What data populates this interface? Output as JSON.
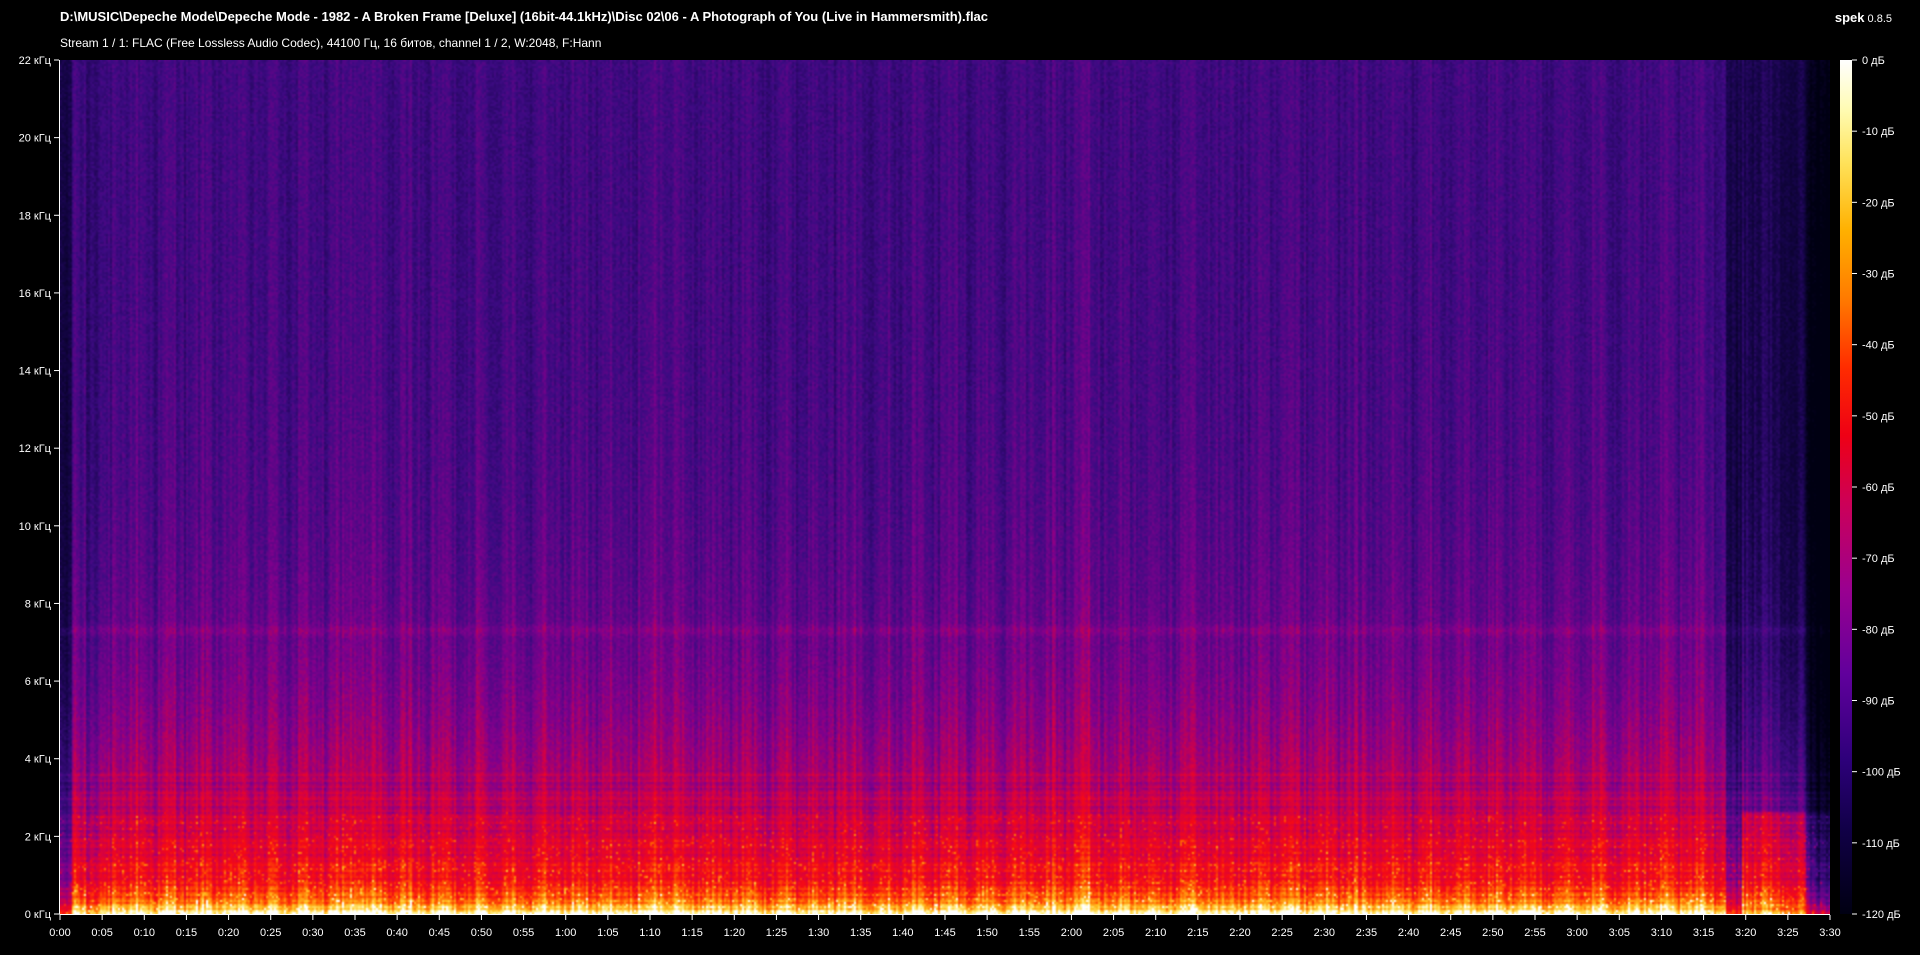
{
  "header": {
    "file_path": "D:\\MUSIC\\Depeche Mode\\Depeche Mode - 1982 - A Broken Frame [Deluxe] (16bit-44.1kHz)\\Disc 02\\06 - A Photograph of You (Live in Hammersmith).flac",
    "stream_info": "Stream 1 / 1: FLAC (Free Lossless Audio Codec), 44100 Гц, 16 битов, channel 1 / 2, W:2048, F:Hann",
    "app_name": "spek",
    "app_version": "0.8.5"
  },
  "chart_data": {
    "type": "heatmap",
    "x_ticks": [
      "0:00",
      "0:05",
      "0:10",
      "0:15",
      "0:20",
      "0:25",
      "0:30",
      "0:35",
      "0:40",
      "0:45",
      "0:50",
      "0:55",
      "1:00",
      "1:05",
      "1:10",
      "1:15",
      "1:20",
      "1:25",
      "1:30",
      "1:35",
      "1:40",
      "1:45",
      "1:50",
      "1:55",
      "2:00",
      "2:05",
      "2:10",
      "2:15",
      "2:20",
      "2:25",
      "2:30",
      "2:35",
      "2:40",
      "2:45",
      "2:50",
      "2:55",
      "3:00",
      "3:05",
      "3:10",
      "3:15",
      "3:20",
      "3:25",
      "3:30"
    ],
    "x_range_seconds": [
      0,
      210
    ],
    "y_ticks": [
      "0 кГц",
      "2 кГц",
      "4 кГц",
      "6 кГц",
      "8 кГц",
      "10 кГц",
      "12 кГц",
      "14 кГц",
      "16 кГц",
      "18 кГц",
      "20 кГц",
      "22 кГц"
    ],
    "y_range_khz": [
      0,
      22
    ],
    "colorbar_ticks": [
      "0 дБ",
      "-10 дБ",
      "-20 дБ",
      "-30 дБ",
      "-40 дБ",
      "-50 дБ",
      "-60 дБ",
      "-70 дБ",
      "-80 дБ",
      "-90 дБ",
      "-100 дБ",
      "-110 дБ",
      "-120 дБ"
    ],
    "colorbar_range_db": [
      -120,
      0
    ],
    "palette": [
      "#000012",
      "#2d007a",
      "#9a0090",
      "#ee0015",
      "#ff7a00",
      "#ffe25a",
      "#ffffff"
    ]
  }
}
